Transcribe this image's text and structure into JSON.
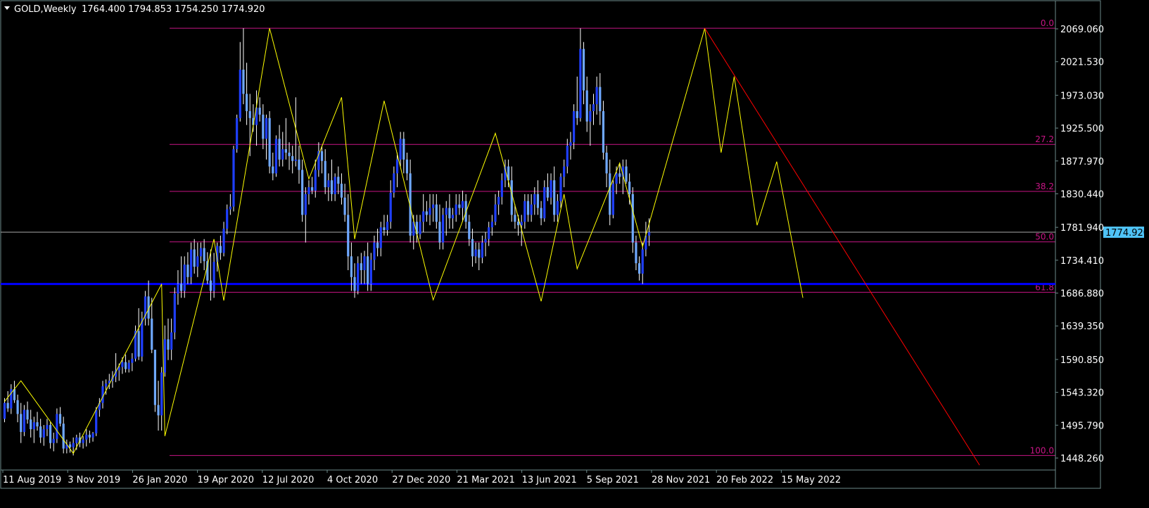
{
  "header": {
    "symbol_label": "GOLD,Weekly",
    "ohlc_text": "1764.400 1794.853 1754.250 1774.920"
  },
  "current_price_label": "1774.920",
  "chart_data": {
    "type": "candlestick",
    "timeframe": "Weekly",
    "ylim": [
      1438,
      2080
    ],
    "price_ticks": [
      "2069.060",
      "2021.530",
      "1973.030",
      "1925.500",
      "1877.970",
      "1830.440",
      "1781.940",
      "1734.410",
      "1686.880",
      "1639.350",
      "1590.850",
      "1543.320",
      "1495.790",
      "1448.260"
    ],
    "date_ticks": [
      "11 Aug 2019",
      "3 Nov 2019",
      "26 Jan 2020",
      "19 Apr 2020",
      "12 Jul 2020",
      "4 Oct 2020",
      "27 Dec 2020",
      "21 Mar 2021",
      "13 Jun 2021",
      "5 Sep 2021",
      "28 Nov 2021",
      "20 Feb 2022",
      "15 May 2022"
    ],
    "current_price": 1774.92,
    "support_level": 1700,
    "fibonacci": {
      "high": 2070,
      "low": 1452,
      "levels": [
        {
          "label": "0.0",
          "ratio": 0.0
        },
        {
          "label": "27.2",
          "ratio": 0.272
        },
        {
          "label": "38.2",
          "ratio": 0.382
        },
        {
          "label": "50.0",
          "ratio": 0.5
        },
        {
          "label": "61.8",
          "ratio": 0.618
        },
        {
          "label": "100.0",
          "ratio": 1.0
        }
      ]
    },
    "zigzag": [
      [
        0,
        1530
      ],
      [
        5,
        1560
      ],
      [
        21,
        1455
      ],
      [
        48,
        1700
      ],
      [
        49,
        1480
      ],
      [
        64,
        1765
      ],
      [
        67,
        1676
      ],
      [
        81,
        2070
      ],
      [
        93,
        1852
      ],
      [
        103,
        1970
      ],
      [
        107,
        1765
      ],
      [
        116,
        1965
      ],
      [
        131,
        1677
      ],
      [
        150,
        1918
      ],
      [
        164,
        1675
      ],
      [
        171,
        1830
      ],
      [
        175,
        1722
      ],
      [
        188,
        1875
      ],
      [
        195,
        1754
      ],
      [
        214,
        2070
      ],
      [
        219,
        1890
      ],
      [
        223,
        2000
      ],
      [
        230,
        1785
      ],
      [
        236,
        1877
      ],
      [
        244,
        1680
      ]
    ],
    "trendline": [
      [
        214,
        2070
      ],
      [
        298,
        1438
      ]
    ],
    "candles": [
      [
        1505,
        1535,
        1500,
        1528
      ],
      [
        1528,
        1545,
        1515,
        1520
      ],
      [
        1520,
        1555,
        1512,
        1548
      ],
      [
        1548,
        1560,
        1528,
        1532
      ],
      [
        1532,
        1540,
        1500,
        1512
      ],
      [
        1512,
        1528,
        1470,
        1486
      ],
      [
        1486,
        1525,
        1480,
        1518
      ],
      [
        1518,
        1530,
        1498,
        1504
      ],
      [
        1504,
        1518,
        1478,
        1490
      ],
      [
        1490,
        1508,
        1470,
        1500
      ],
      [
        1500,
        1515,
        1488,
        1494
      ],
      [
        1494,
        1505,
        1470,
        1478
      ],
      [
        1478,
        1496,
        1466,
        1490
      ],
      [
        1490,
        1505,
        1480,
        1496
      ],
      [
        1496,
        1500,
        1462,
        1470
      ],
      [
        1470,
        1485,
        1458,
        1476
      ],
      [
        1476,
        1520,
        1470,
        1512
      ],
      [
        1512,
        1522,
        1494,
        1498
      ],
      [
        1498,
        1508,
        1455,
        1462
      ],
      [
        1462,
        1475,
        1455,
        1468
      ],
      [
        1468,
        1472,
        1456,
        1464
      ],
      [
        1464,
        1478,
        1452,
        1470
      ],
      [
        1470,
        1482,
        1460,
        1478
      ],
      [
        1478,
        1485,
        1464,
        1470
      ],
      [
        1470,
        1480,
        1462,
        1475
      ],
      [
        1475,
        1490,
        1465,
        1482
      ],
      [
        1482,
        1488,
        1470,
        1478
      ],
      [
        1478,
        1486,
        1472,
        1484
      ],
      [
        1484,
        1522,
        1480,
        1518
      ],
      [
        1518,
        1535,
        1508,
        1528
      ],
      [
        1528,
        1560,
        1520,
        1552
      ],
      [
        1552,
        1562,
        1540,
        1556
      ],
      [
        1556,
        1570,
        1548,
        1560
      ],
      [
        1560,
        1574,
        1550,
        1566
      ],
      [
        1566,
        1600,
        1558,
        1575
      ],
      [
        1575,
        1585,
        1560,
        1580
      ],
      [
        1580,
        1594,
        1570,
        1587
      ],
      [
        1587,
        1598,
        1572,
        1577
      ],
      [
        1577,
        1590,
        1572,
        1586
      ],
      [
        1586,
        1600,
        1574,
        1592
      ],
      [
        1592,
        1640,
        1588,
        1632
      ],
      [
        1632,
        1665,
        1590,
        1595
      ],
      [
        1595,
        1660,
        1588,
        1650
      ],
      [
        1650,
        1690,
        1640,
        1682
      ],
      [
        1682,
        1705,
        1640,
        1650
      ],
      [
        1650,
        1680,
        1600,
        1605
      ],
      [
        1605,
        1605,
        1515,
        1525
      ],
      [
        1525,
        1560,
        1488,
        1510
      ],
      [
        1510,
        1580,
        1488,
        1572
      ],
      [
        1572,
        1640,
        1566,
        1620
      ],
      [
        1620,
        1650,
        1590,
        1605
      ],
      [
        1605,
        1650,
        1590,
        1630
      ],
      [
        1630,
        1695,
        1620,
        1686
      ],
      [
        1686,
        1720,
        1670,
        1700
      ],
      [
        1700,
        1740,
        1680,
        1690
      ],
      [
        1690,
        1740,
        1680,
        1728
      ],
      [
        1728,
        1746,
        1700,
        1710
      ],
      [
        1710,
        1760,
        1700,
        1750
      ],
      [
        1750,
        1765,
        1715,
        1725
      ],
      [
        1725,
        1760,
        1710,
        1740
      ],
      [
        1740,
        1760,
        1730,
        1752
      ],
      [
        1752,
        1765,
        1720,
        1733
      ],
      [
        1733,
        1746,
        1700,
        1705
      ],
      [
        1705,
        1750,
        1676,
        1690
      ],
      [
        1690,
        1745,
        1680,
        1732
      ],
      [
        1732,
        1760,
        1718,
        1755
      ],
      [
        1755,
        1770,
        1735,
        1745
      ],
      [
        1745,
        1790,
        1740,
        1780
      ],
      [
        1780,
        1815,
        1772,
        1808
      ],
      [
        1808,
        1830,
        1800,
        1812
      ],
      [
        1812,
        1900,
        1805,
        1895
      ],
      [
        1895,
        1945,
        1890,
        1940
      ],
      [
        1940,
        2050,
        1935,
        2010
      ],
      [
        2010,
        2070,
        1960,
        1975
      ],
      [
        1975,
        2020,
        1930,
        1950
      ],
      [
        1950,
        1975,
        1885,
        1940
      ],
      [
        1940,
        1960,
        1920,
        1930
      ],
      [
        1930,
        1980,
        1900,
        1955
      ],
      [
        1955,
        1970,
        1935,
        1945
      ],
      [
        1945,
        1960,
        1895,
        1910
      ],
      [
        1910,
        1945,
        1880,
        1940
      ],
      [
        1940,
        1950,
        1860,
        1870
      ],
      [
        1870,
        1890,
        1850,
        1860
      ],
      [
        1860,
        1915,
        1855,
        1910
      ],
      [
        1910,
        1930,
        1870,
        1880
      ],
      [
        1880,
        1920,
        1870,
        1895
      ],
      [
        1895,
        1940,
        1880,
        1890
      ],
      [
        1890,
        1905,
        1865,
        1885
      ],
      [
        1885,
        1900,
        1860,
        1878
      ],
      [
        1878,
        1970,
        1870,
        1880
      ],
      [
        1880,
        1900,
        1845,
        1865
      ],
      [
        1865,
        1880,
        1790,
        1800
      ],
      [
        1800,
        1840,
        1760,
        1830
      ],
      [
        1830,
        1850,
        1815,
        1840
      ],
      [
        1840,
        1855,
        1830,
        1835
      ],
      [
        1835,
        1880,
        1825,
        1865
      ],
      [
        1865,
        1905,
        1855,
        1892
      ],
      [
        1892,
        1900,
        1860,
        1878
      ],
      [
        1878,
        1895,
        1830,
        1840
      ],
      [
        1840,
        1860,
        1820,
        1850
      ],
      [
        1850,
        1880,
        1820,
        1830
      ],
      [
        1830,
        1860,
        1820,
        1855
      ],
      [
        1855,
        1870,
        1830,
        1845
      ],
      [
        1845,
        1860,
        1815,
        1825
      ],
      [
        1825,
        1845,
        1790,
        1800
      ],
      [
        1800,
        1830,
        1720,
        1740
      ],
      [
        1740,
        1760,
        1690,
        1710
      ],
      [
        1710,
        1730,
        1680,
        1690
      ],
      [
        1690,
        1740,
        1685,
        1730
      ],
      [
        1730,
        1745,
        1700,
        1720
      ],
      [
        1720,
        1748,
        1700,
        1740
      ],
      [
        1740,
        1760,
        1690,
        1700
      ],
      [
        1700,
        1745,
        1690,
        1735
      ],
      [
        1735,
        1770,
        1720,
        1760
      ],
      [
        1760,
        1780,
        1740,
        1752
      ],
      [
        1752,
        1790,
        1740,
        1782
      ],
      [
        1782,
        1800,
        1770,
        1778
      ],
      [
        1778,
        1800,
        1770,
        1790
      ],
      [
        1790,
        1850,
        1780,
        1832
      ],
      [
        1832,
        1870,
        1825,
        1860
      ],
      [
        1860,
        1890,
        1840,
        1880
      ],
      [
        1880,
        1920,
        1870,
        1910
      ],
      [
        1910,
        1920,
        1860,
        1880
      ],
      [
        1880,
        1890,
        1850,
        1860
      ],
      [
        1860,
        1880,
        1760,
        1770
      ],
      [
        1770,
        1800,
        1750,
        1790
      ],
      [
        1790,
        1800,
        1760,
        1772
      ],
      [
        1772,
        1800,
        1765,
        1790
      ],
      [
        1790,
        1830,
        1775,
        1805
      ],
      [
        1805,
        1820,
        1790,
        1800
      ],
      [
        1800,
        1830,
        1785,
        1810
      ],
      [
        1810,
        1830,
        1790,
        1815
      ],
      [
        1815,
        1830,
        1780,
        1790
      ],
      [
        1790,
        1815,
        1750,
        1760
      ],
      [
        1760,
        1810,
        1750,
        1800
      ],
      [
        1800,
        1820,
        1770,
        1810
      ],
      [
        1810,
        1830,
        1780,
        1795
      ],
      [
        1795,
        1810,
        1780,
        1800
      ],
      [
        1800,
        1830,
        1790,
        1815
      ],
      [
        1815,
        1830,
        1800,
        1810
      ],
      [
        1810,
        1835,
        1790,
        1820
      ],
      [
        1820,
        1830,
        1780,
        1790
      ],
      [
        1790,
        1800,
        1755,
        1765
      ],
      [
        1765,
        1780,
        1725,
        1740
      ],
      [
        1740,
        1760,
        1730,
        1750
      ],
      [
        1750,
        1760,
        1720,
        1738
      ],
      [
        1738,
        1770,
        1730,
        1760
      ],
      [
        1760,
        1775,
        1740,
        1765
      ],
      [
        1765,
        1790,
        1755,
        1782
      ],
      [
        1782,
        1800,
        1770,
        1790
      ],
      [
        1790,
        1830,
        1785,
        1815
      ],
      [
        1815,
        1835,
        1800,
        1826
      ],
      [
        1826,
        1860,
        1815,
        1850
      ],
      [
        1850,
        1880,
        1840,
        1870
      ],
      [
        1870,
        1880,
        1840,
        1850
      ],
      [
        1850,
        1870,
        1790,
        1800
      ],
      [
        1800,
        1815,
        1780,
        1790
      ],
      [
        1790,
        1800,
        1770,
        1785
      ],
      [
        1785,
        1800,
        1755,
        1790
      ],
      [
        1790,
        1830,
        1780,
        1820
      ],
      [
        1820,
        1830,
        1790,
        1800
      ],
      [
        1800,
        1830,
        1790,
        1815
      ],
      [
        1815,
        1840,
        1800,
        1830
      ],
      [
        1830,
        1850,
        1800,
        1810
      ],
      [
        1810,
        1820,
        1785,
        1795
      ],
      [
        1795,
        1850,
        1790,
        1840
      ],
      [
        1840,
        1860,
        1820,
        1825
      ],
      [
        1825,
        1860,
        1815,
        1850
      ],
      [
        1850,
        1870,
        1790,
        1800
      ],
      [
        1800,
        1830,
        1790,
        1820
      ],
      [
        1820,
        1860,
        1810,
        1855
      ],
      [
        1855,
        1880,
        1840,
        1870
      ],
      [
        1870,
        1910,
        1860,
        1900
      ],
      [
        1900,
        1920,
        1880,
        1905
      ],
      [
        1905,
        1960,
        1895,
        1950
      ],
      [
        1950,
        2000,
        1930,
        1940
      ],
      [
        1940,
        2070,
        1935,
        2040
      ],
      [
        2040,
        2050,
        1960,
        1980
      ],
      [
        1980,
        2000,
        1920,
        1935
      ],
      [
        1935,
        1960,
        1900,
        1950
      ],
      [
        1950,
        1975,
        1930,
        1960
      ],
      [
        1960,
        2000,
        1945,
        1985
      ],
      [
        1985,
        2005,
        1930,
        1950
      ],
      [
        1950,
        1965,
        1880,
        1890
      ],
      [
        1890,
        1900,
        1840,
        1860
      ],
      [
        1860,
        1880,
        1785,
        1800
      ],
      [
        1800,
        1850,
        1795,
        1845
      ],
      [
        1845,
        1870,
        1830,
        1860
      ],
      [
        1860,
        1875,
        1845,
        1855
      ],
      [
        1855,
        1880,
        1830,
        1870
      ],
      [
        1870,
        1880,
        1845,
        1848
      ],
      [
        1848,
        1860,
        1815,
        1830
      ],
      [
        1830,
        1840,
        1745,
        1760
      ],
      [
        1760,
        1770,
        1720,
        1730
      ],
      [
        1730,
        1740,
        1705,
        1715
      ],
      [
        1715,
        1760,
        1700,
        1750
      ],
      [
        1750,
        1790,
        1740,
        1770
      ],
      [
        1770,
        1795,
        1755,
        1775
      ]
    ]
  }
}
